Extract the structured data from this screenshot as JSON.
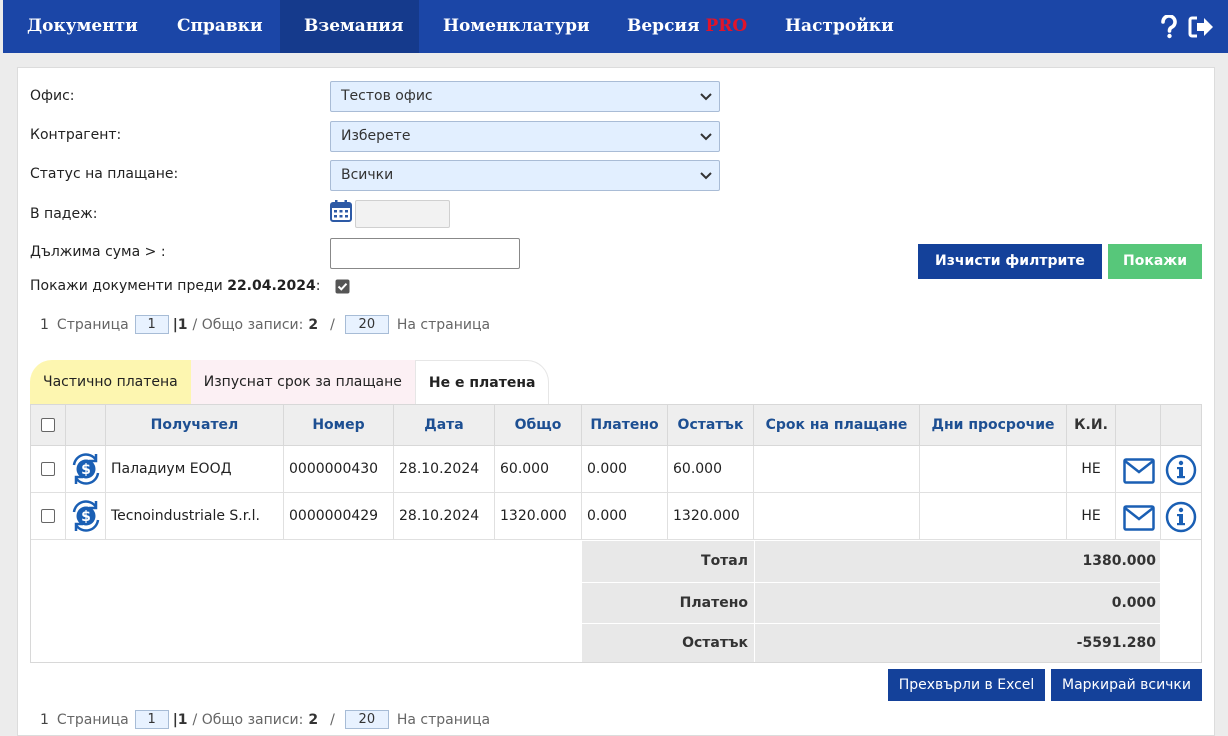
{
  "nav": {
    "items": [
      {
        "label": "Документи"
      },
      {
        "label": "Справки"
      },
      {
        "label": "Вземания"
      },
      {
        "label": "Номенклатури"
      },
      {
        "label": "Версия",
        "badge": "PRO"
      },
      {
        "label": "Настройки"
      }
    ],
    "active": "Вземания",
    "icons": [
      "help-icon",
      "logout-icon"
    ]
  },
  "filters": {
    "office_label": "Офис:",
    "office_value": "Тестов офис",
    "partner_label": "Контрагент:",
    "partner_value": "Изберете",
    "status_label": "Статус на плащане:",
    "status_value": "Всички",
    "due_label": "В падеж:",
    "due_value": "",
    "amount_label": "Дължима сума > :",
    "amount_value": "",
    "show_before_label": "Покажи документи преди",
    "show_before_date": "22.04.2024",
    "show_before_suffix": ":",
    "show_before_checked": true
  },
  "buttons": {
    "clear": "Изчисти филтрите",
    "show": "Покажи",
    "excel": "Прехвърли в Excel",
    "mark_all": "Маркирай всички"
  },
  "pager": {
    "first": "1",
    "page_label": "Страница",
    "page": "1",
    "total_pages": "|1",
    "total_label": "/ Общо записи:",
    "total_records": "2",
    "slash": "/",
    "per_page": "20",
    "per_page_label": "На страница"
  },
  "tabs": [
    {
      "label": "Частично платена"
    },
    {
      "label": "Изпуснат срок за плащане"
    },
    {
      "label": "Не е платена"
    }
  ],
  "table": {
    "columns": [
      "Получател",
      "Номер",
      "Дата",
      "Общо",
      "Платено",
      "Остатък",
      "Срок на плащане",
      "Дни просрочие",
      "К.И."
    ],
    "rows": [
      {
        "recipient": "Паладиум ЕООД",
        "number": "0000000430",
        "date": "28.10.2024",
        "total": "60.000",
        "paid": "0.000",
        "remaining": "60.000",
        "due": "",
        "overdue": "",
        "ki": "НЕ"
      },
      {
        "recipient": "Tecnoindustriale S.r.l.",
        "number": "0000000429",
        "date": "28.10.2024",
        "total": "1320.000",
        "paid": "0.000",
        "remaining": "1320.000",
        "due": "",
        "overdue": "",
        "ki": "НЕ"
      }
    ],
    "summary": [
      {
        "label": "Тотал",
        "value": "1380.000"
      },
      {
        "label": "Платено",
        "value": "0.000"
      },
      {
        "label": "Остатък",
        "value": "-5591.280"
      }
    ]
  },
  "colors": {
    "nav_bg": "#1b46a7",
    "nav_active": "#153a8c",
    "pro": "#e0142a",
    "button_blue": "#14419a",
    "button_green": "#57c77a",
    "header_text": "#1d4f92"
  }
}
